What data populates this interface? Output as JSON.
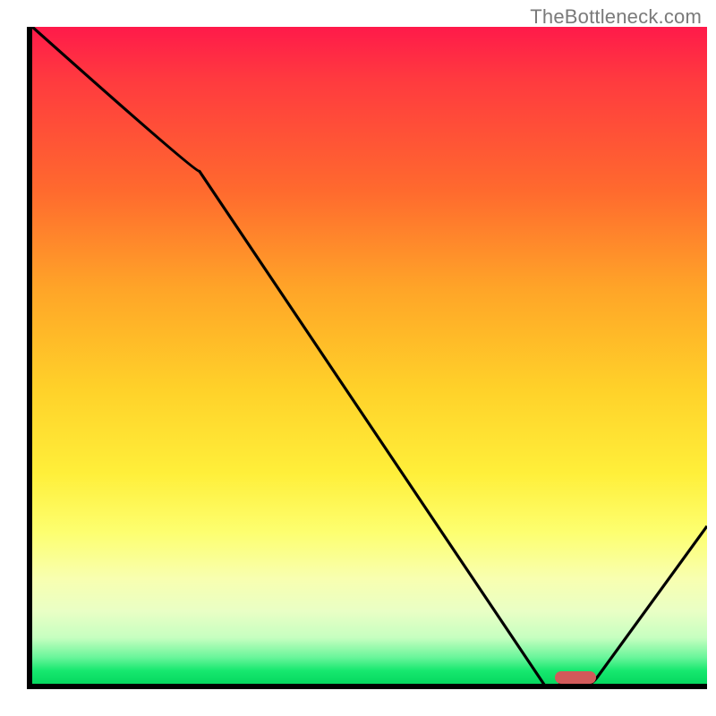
{
  "watermark": "TheBottleneck.com",
  "chart_data": {
    "type": "line",
    "title": "",
    "xlabel": "",
    "ylabel": "",
    "x": [
      0,
      24,
      78,
      83,
      100
    ],
    "values": [
      100,
      78,
      0,
      0,
      24
    ],
    "xlim": [
      0,
      100
    ],
    "ylim": [
      0,
      100
    ],
    "marker": {
      "x_start": 78,
      "x_end": 83,
      "y": 0
    },
    "colors": {
      "high": "#ff1a4a",
      "mid": "#ffe63a",
      "low": "#05d85f",
      "marker": "#d25a5a"
    },
    "annotations": []
  },
  "layout": {
    "plot": {
      "left": 30,
      "top": 30,
      "inner_width": 754,
      "inner_height": 734
    }
  }
}
